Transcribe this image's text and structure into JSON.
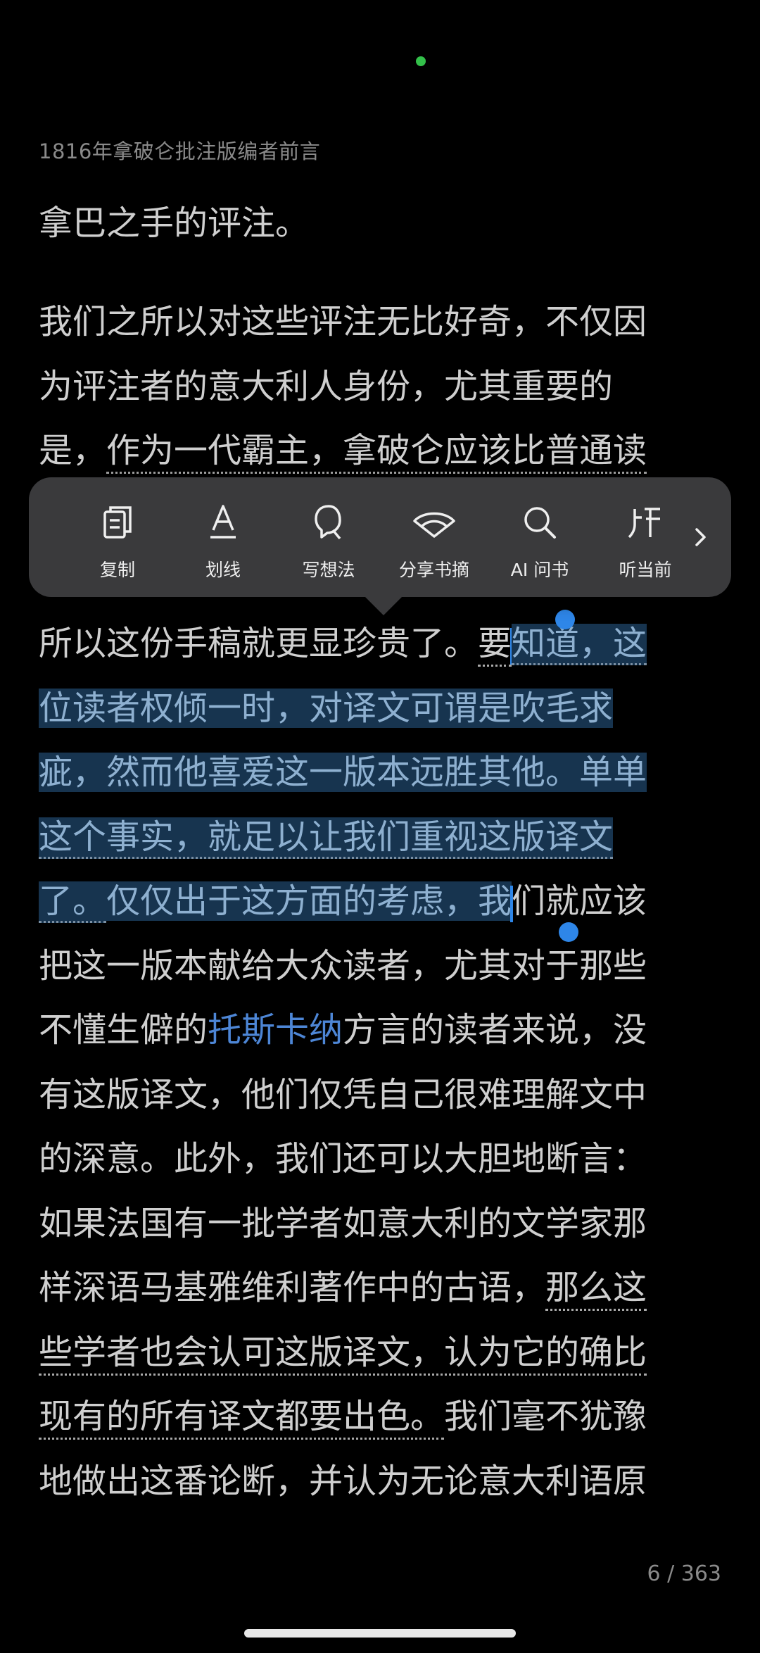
{
  "chapter_title": "1816年拿破仑批注版编者前言",
  "paragraph_1": "拿巴之手的评注。",
  "lines": [
    {
      "text": "我们之所以对这些评注无比好奇，不仅因"
    },
    {
      "text": "为评注者的意大利人身份，尤其重要的"
    },
    {
      "pre": "是，",
      "ul": "作为一代霸主，拿破仑应该比普通读"
    },
    {
      "pre": "所以这份手稿就更显珍贵了。",
      "cursor_before": "要",
      "hl": "知道，这"
    },
    {
      "hl": "位读者权倾一时，对译文可谓是吹毛求"
    },
    {
      "hl": "疵，然而他喜爱这一版本远胜其他。单单"
    },
    {
      "hl": "这个事实，就足以让我们重视这版译文"
    },
    {
      "hl_ul": "了。",
      "hl": "仅仅出于这方面的考虑，我",
      "post": "们就应该"
    },
    {
      "text": "把这一版本献给大众读者，尤其对于那些"
    },
    {
      "pre": "不懂生僻的",
      "link": "托斯卡纳",
      "post": "方言的读者来说，没"
    },
    {
      "text": "有这版译文，他们仅凭自己很难理解文中"
    },
    {
      "text": "的深意。此外，我们还可以大胆地断言："
    },
    {
      "text": "如果法国有一批学者如意大利的文学家那"
    },
    {
      "pre": "样深语马基雅维利著作中的古语，",
      "ul": "那么这"
    },
    {
      "ul": "些学者也会认可这版译文，认为它的确比"
    },
    {
      "ul": "现有的所有译文都要出色。",
      "post": "我们毫不犹豫"
    },
    {
      "text": "地做出这番论断，并认为无论意大利语原"
    }
  ],
  "toolbar": {
    "copy": "复制",
    "underline": "划线",
    "write_thought": "写想法",
    "share_excerpt": "分享书摘",
    "ai_ask": "AI 问书",
    "listen_current": "听当前"
  },
  "page_number": "6 / 363",
  "colors": {
    "background": "#000000",
    "text": "#cfcfcf",
    "selection": "#17344f",
    "accent": "#2e86e8",
    "link": "#4d86d6",
    "toolbar": "#3a3a3c"
  }
}
